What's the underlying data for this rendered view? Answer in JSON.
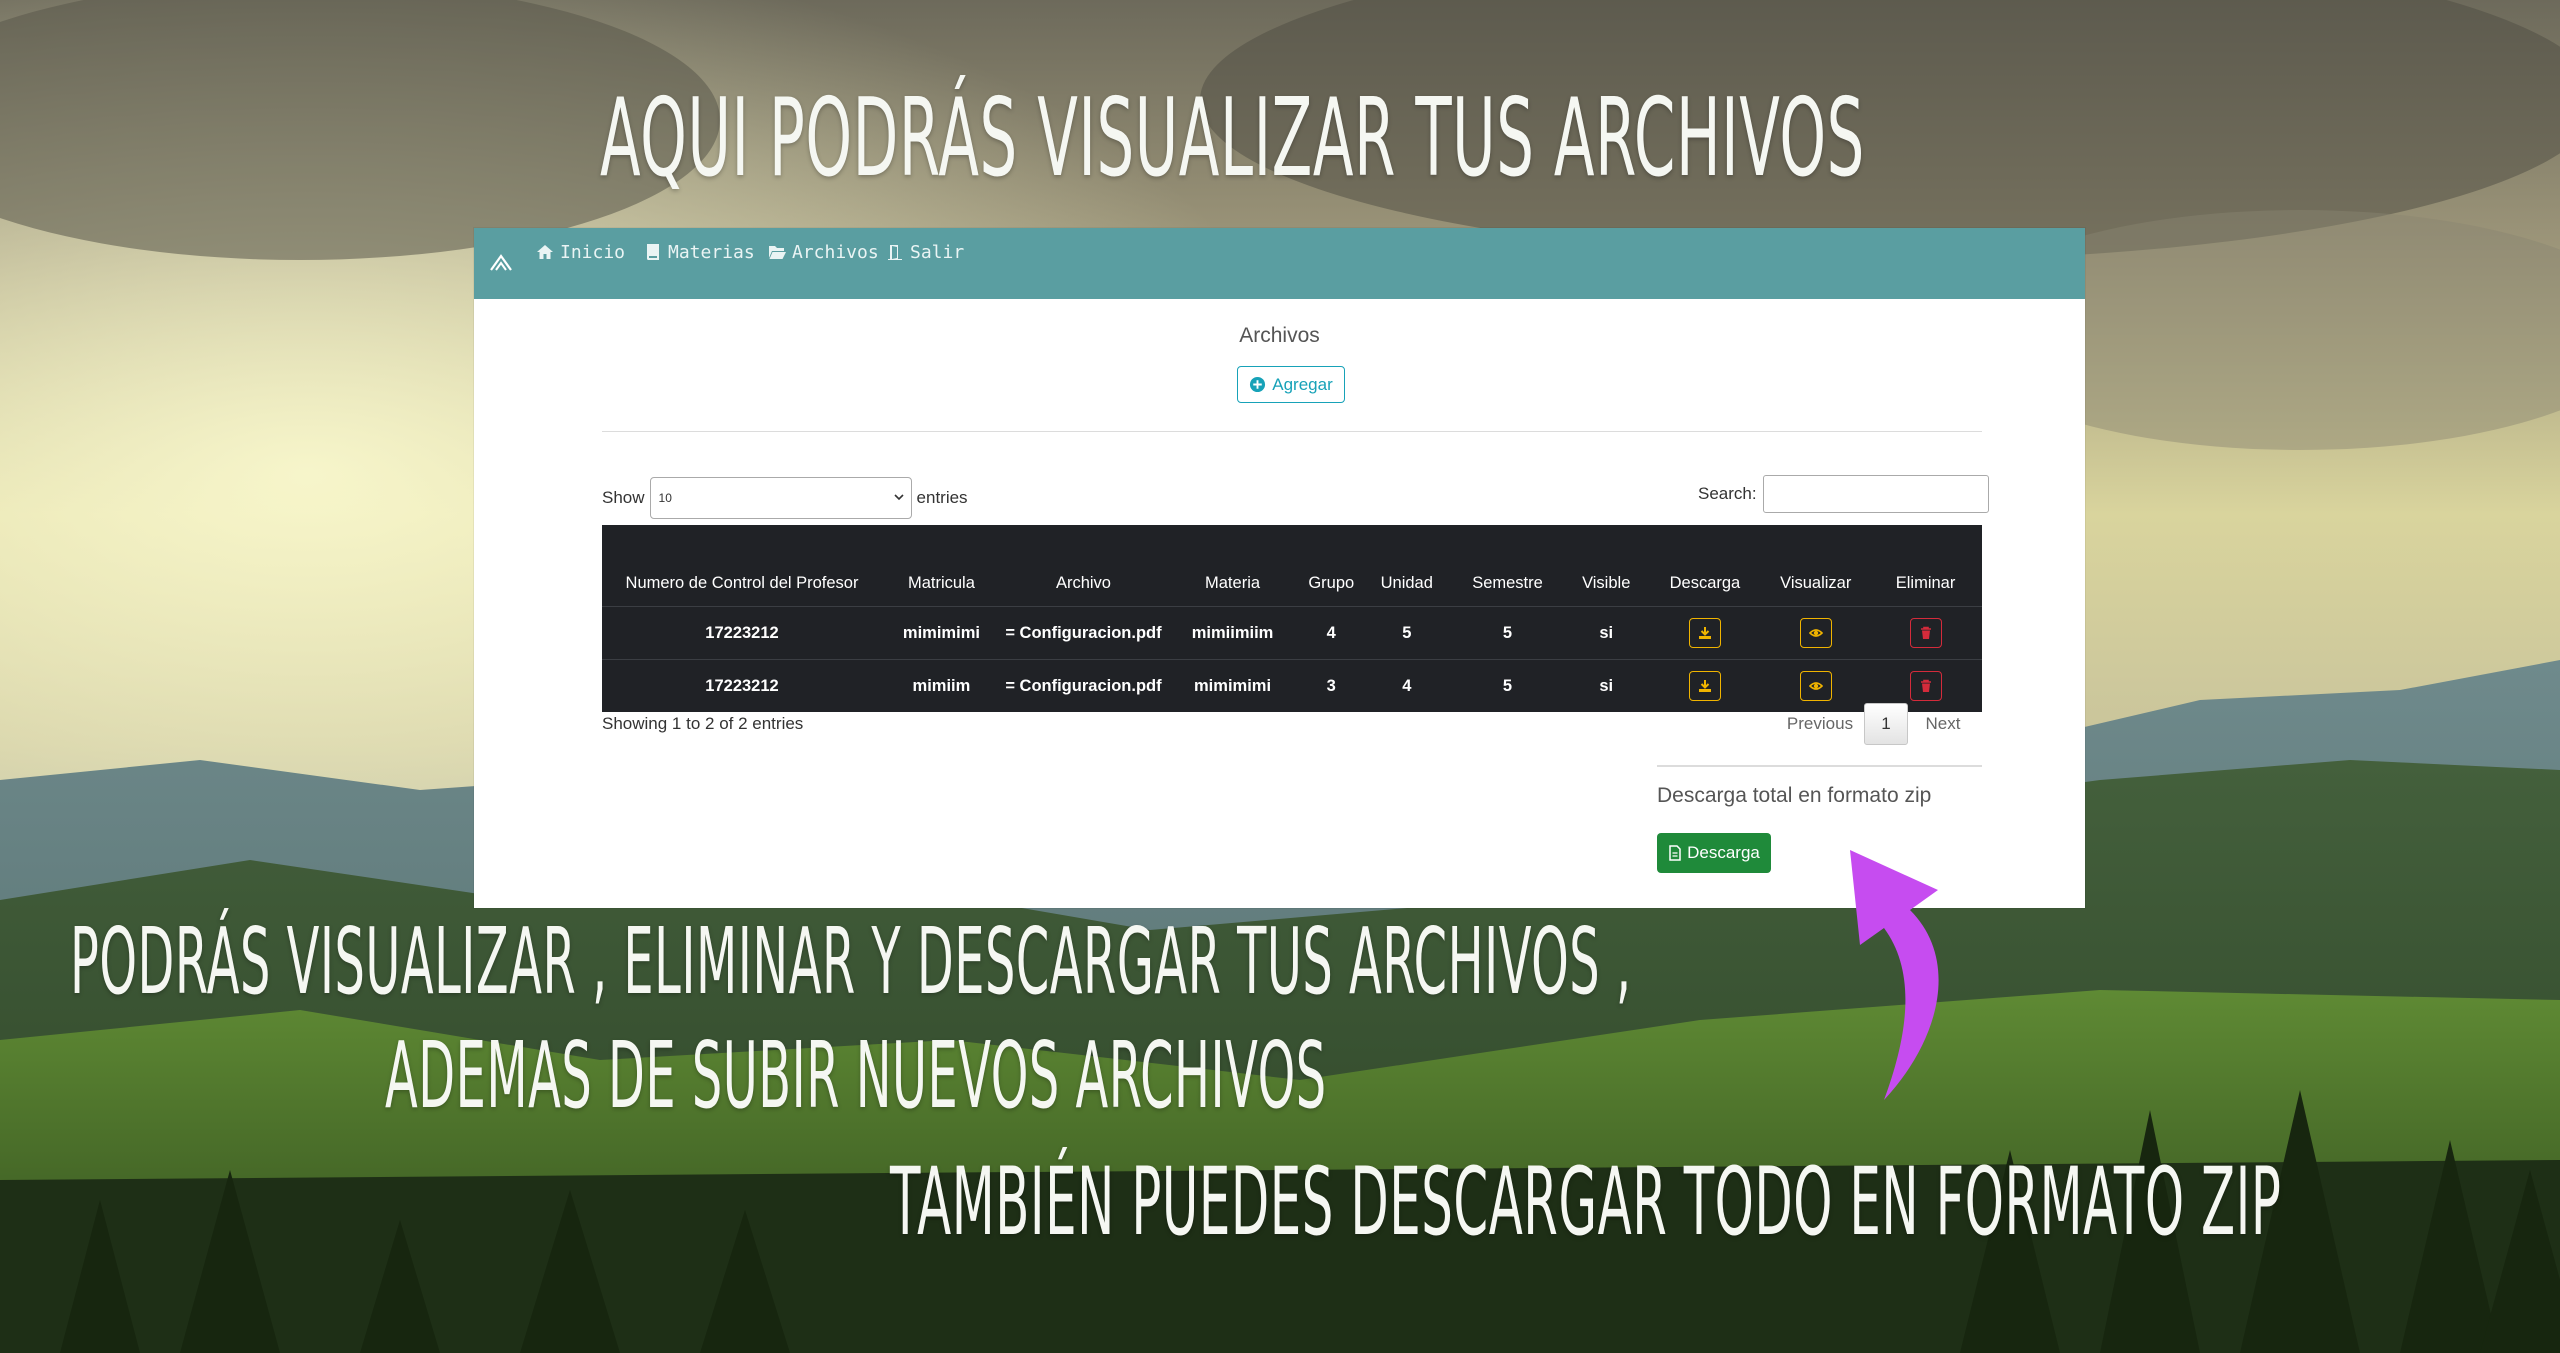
{
  "poster": {
    "title": "AQUI PODRÁS VISUALIZAR TUS ARCHIVOS",
    "line1": "PODRÁS VISUALIZAR , ELIMINAR Y DESCARGAR TUS ARCHIVOS ,",
    "line2": "ADEMAS DE SUBIR NUEVOS ARCHIVOS",
    "line3": "TAMBIÉN PUEDES DESCARGAR TODO EN FORMATO ZIP",
    "arrow_color": "#c64cf0"
  },
  "navbar": {
    "color": "#5a9ea1",
    "items": [
      {
        "label": "Inicio",
        "icon": "home-icon"
      },
      {
        "label": "Materias",
        "icon": "book-icon"
      },
      {
        "label": "Archivos",
        "icon": "folder-open-icon"
      },
      {
        "label": "Salir",
        "icon": "door-icon"
      }
    ]
  },
  "main": {
    "heading": "Archivos",
    "add_label": "Agregar",
    "show_label": "Show",
    "page_length": "10",
    "entries_label": "entries",
    "search_label": "Search:",
    "table": {
      "headers": {
        "profesor": "Numero de Control del Profesor",
        "matricula": "Matricula",
        "archivo": "Archivo",
        "materia": "Materia",
        "grupo": "Grupo",
        "unidad": "Unidad",
        "semestre": "Semestre",
        "visible": "Visible",
        "descarga": "Descarga",
        "visualizar": "Visualizar",
        "eliminar": "Eliminar"
      },
      "rows": [
        {
          "profesor": "17223212",
          "matricula": "mimimimi",
          "archivo": "= Configuracion.pdf",
          "materia": "mimiimiim",
          "grupo": "4",
          "unidad": "5",
          "semestre": "5",
          "visible": "si"
        },
        {
          "profesor": "17223212",
          "matricula": "mimiim",
          "archivo": "= Configuracion.pdf",
          "materia": "mimimimi",
          "grupo": "3",
          "unidad": "4",
          "semestre": "5",
          "visible": "si"
        }
      ]
    },
    "info": "Showing 1 to 2 of 2 entries",
    "pagination": {
      "previous": "Previous",
      "current": "1",
      "next": "Next"
    },
    "zip_label": "Descarga total en formato zip",
    "zip_button": "Descarga"
  }
}
